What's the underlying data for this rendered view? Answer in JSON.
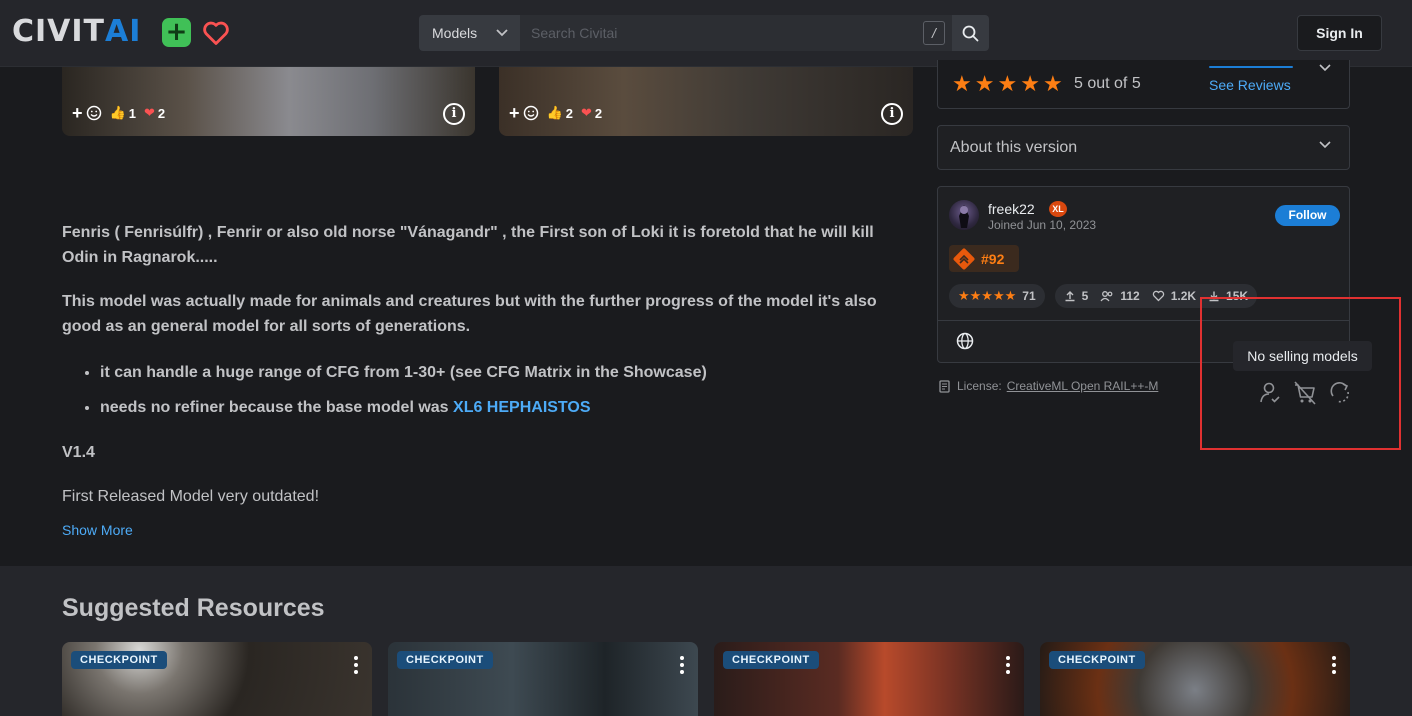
{
  "header": {
    "logo_part1": "CIVIT",
    "logo_part2": "AI",
    "plus_symbol": "+",
    "search_type": "Models",
    "search_placeholder": "Search Civitai",
    "search_shortcut": "/",
    "signin_label": "Sign In"
  },
  "images": [
    {
      "reaction_add": "+",
      "likes": "1",
      "hearts": "2"
    },
    {
      "reaction_add": "+",
      "likes": "2",
      "hearts": "2"
    }
  ],
  "description": {
    "p1": "Fenris ( Fenrisúlfr) , Fenrir or also old norse \"Vánagandr\" , the First son of Loki it is foretold that he will kill Odin in Ragnarok.....",
    "p2": "This model was actually made for animals and creatures but with the further progress of the model it's also good as an general model for all sorts of generations.",
    "bullet1": "it can handle a huge range of CFG from 1-30+ (see CFG Matrix in the Showcase)",
    "bullet2_prefix": "needs no refiner because the base model was ",
    "bullet2_link": "XL6 HEPHAISTOS",
    "version": "V1.4",
    "released": "First Released Model very outdated!",
    "show_more": "Show More"
  },
  "reviews": {
    "stars": 5,
    "rating_text": "5 out of 5",
    "see_reviews": "See Reviews"
  },
  "about": {
    "label": "About this version"
  },
  "creator": {
    "username": "freek22",
    "badge": "XL",
    "joined": "Joined Jun 10, 2023",
    "follow_label": "Follow",
    "rank": "#92",
    "rating_count": "71",
    "uploads": "5",
    "followers": "112",
    "likes": "1.2K",
    "downloads": "15K"
  },
  "license": {
    "prefix": "License:",
    "name": "CreativeML Open RAIL++-M"
  },
  "tooltip": {
    "text": "No selling models"
  },
  "suggested": {
    "title": "Suggested Resources",
    "cards": [
      {
        "type": "CHECKPOINT"
      },
      {
        "type": "CHECKPOINT"
      },
      {
        "type": "CHECKPOINT"
      },
      {
        "type": "CHECKPOINT"
      }
    ]
  },
  "colors": {
    "accent_blue": "#1c7ed6",
    "link_blue": "#4dabf7",
    "star_orange": "#fd7e14",
    "highlight_red": "#e03131",
    "plus_green": "#40c057"
  }
}
